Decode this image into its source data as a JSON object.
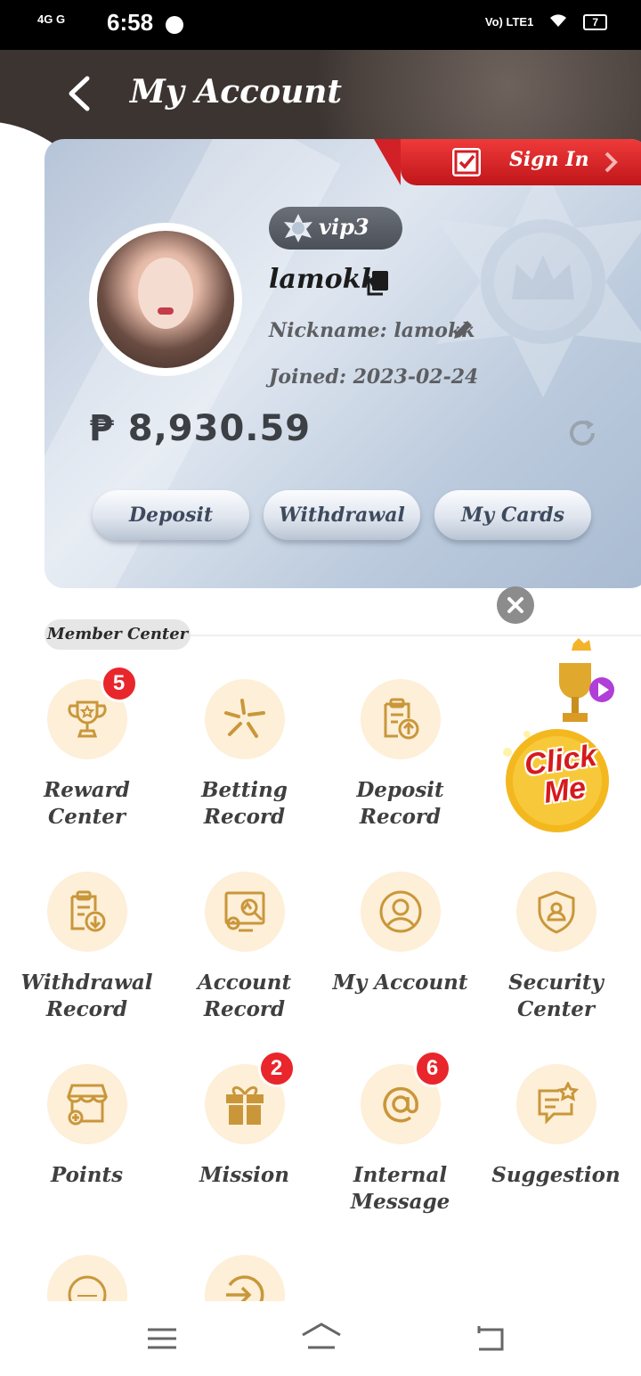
{
  "status_bar": {
    "network": "4G G",
    "time": "6:58",
    "right_indicators": "Vo) LTE1",
    "battery": "7"
  },
  "header": {
    "title": "My Account"
  },
  "account": {
    "sign_in_label": "Sign In",
    "vip_level": "vip3",
    "username": "lamokk",
    "nickname": "Nickname: lamokk",
    "joined": "Joined:  2023-02-24",
    "balance": "₱ 8,930.59",
    "buttons": {
      "deposit": "Deposit",
      "withdrawal": "Withdrawal",
      "my_cards": "My Cards"
    }
  },
  "member_center": {
    "title": "Member Center",
    "items": [
      {
        "label": "Reward Center",
        "badge": "5",
        "icon": "trophy-icon"
      },
      {
        "label": "Betting Record",
        "icon": "sparkle-icon"
      },
      {
        "label": "Deposit Record",
        "icon": "clipboard-upload-icon"
      },
      {
        "label": "Withdrawal Record",
        "icon": "clipboard-download-icon"
      },
      {
        "label": "Account Record",
        "icon": "chart-search-icon"
      },
      {
        "label": "My Account",
        "icon": "user-icon"
      },
      {
        "label": "Security Center",
        "icon": "shield-user-icon"
      },
      {
        "label": "Points",
        "icon": "store-icon"
      },
      {
        "label": "Mission",
        "badge": "2",
        "icon": "gift-icon"
      },
      {
        "label": "Internal Message",
        "badge": "6",
        "icon": "at-icon"
      },
      {
        "label": "Suggestion",
        "icon": "chat-star-icon"
      },
      {
        "label": "",
        "icon": "support-24-7-icon"
      },
      {
        "label": "",
        "icon": "logout-icon"
      }
    ]
  },
  "promo": {
    "text": "Click Me"
  },
  "colors": {
    "accent_red": "#e8262b",
    "icon_gold": "#c9973a",
    "icon_bg": "#fdefd8",
    "header_dark": "#3b3431"
  }
}
